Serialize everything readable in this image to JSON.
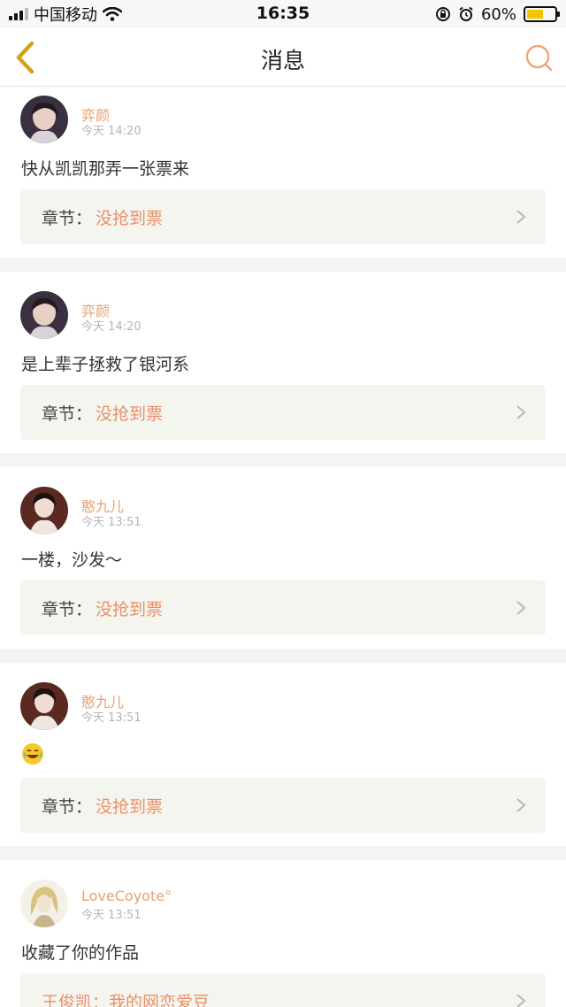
{
  "status_bar": {
    "carrier": "中国移动",
    "time": "16:35",
    "battery": "60%"
  },
  "nav": {
    "title": "消息",
    "back_icon": "chevron-left-icon",
    "search_icon": "search-icon"
  },
  "colors": {
    "accent": "#e8906a",
    "username": "#e8a070",
    "chapter_bg": "#f5f5ef",
    "separator": "#f4f4f6"
  },
  "messages": [
    {
      "user": "弈颜",
      "time": "今天 14:20",
      "text": "快从凯凯那弄一张票来",
      "chapter_label": "章节：",
      "chapter_value": "没抢到票"
    },
    {
      "user": "弈颜",
      "time": "今天 14:20",
      "text": "是上辈子拯救了银河系",
      "chapter_label": "章节：",
      "chapter_value": "没抢到票"
    },
    {
      "user": "憨九儿",
      "time": "今天 13:51",
      "text": "一楼，沙发～",
      "chapter_label": "章节：",
      "chapter_value": "没抢到票"
    },
    {
      "user": "憨九儿",
      "time": "今天 13:51",
      "emoji": "laughing-tears-emoji",
      "chapter_label": "章节：",
      "chapter_value": "没抢到票"
    },
    {
      "user": "LoveCoyote°",
      "time": "今天 13:51",
      "text": "收藏了你的作品",
      "work": "王俊凯：我的网恋爱豆"
    }
  ]
}
